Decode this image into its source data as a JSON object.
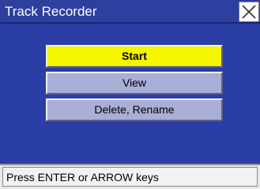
{
  "window": {
    "title": "Track Recorder",
    "close_icon": "close-x-icon"
  },
  "menu": {
    "items": [
      {
        "label": "Start",
        "selected": true
      },
      {
        "label": "View",
        "selected": false
      },
      {
        "label": "Delete, Rename",
        "selected": false
      }
    ]
  },
  "status": {
    "text": "Press ENTER or ARROW keys"
  },
  "colors": {
    "background": "#2a3ea6",
    "selected": "#f5f500",
    "button": "#a9aed6",
    "status_bg": "#f2f2f2"
  }
}
